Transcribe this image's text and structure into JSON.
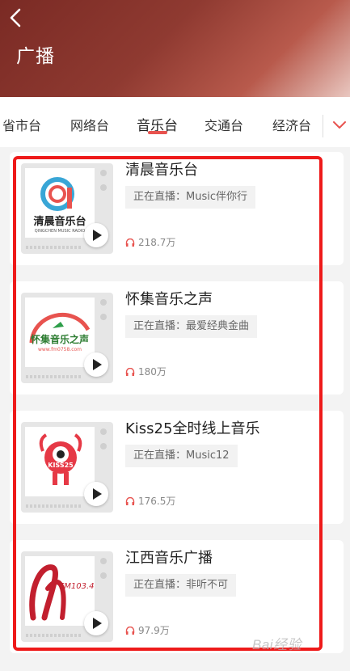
{
  "header": {
    "title": "广播"
  },
  "tabs": [
    {
      "label": "省市台"
    },
    {
      "label": "网络台"
    },
    {
      "label": "音乐台"
    },
    {
      "label": "交通台"
    },
    {
      "label": "经济台"
    }
  ],
  "active_tab": 2,
  "stations": [
    {
      "name": "清晨音乐台",
      "live": "正在直播：Music伴你行",
      "listeners": "218.7万",
      "logo_text": "清晨音乐台",
      "logo_sub": "QINGCHEN MUSIC RADIO"
    },
    {
      "name": "怀集音乐之声",
      "live": "正在直播：最爱经典金曲",
      "listeners": "180万",
      "logo_text": "怀集音乐之声",
      "logo_sub": "www.fm0758.com"
    },
    {
      "name": "Kiss25全时线上音乐",
      "live": "正在直播：Music12",
      "listeners": "176.5万",
      "logo_text": "KISS25"
    },
    {
      "name": "江西音乐广播",
      "live": "正在直播：非听不可",
      "listeners": "97.9万",
      "logo_text": "FM103.4"
    }
  ],
  "colors": {
    "accent": "#e8534f",
    "highlight": "#ee1a1a"
  },
  "watermark": "Bai经验"
}
